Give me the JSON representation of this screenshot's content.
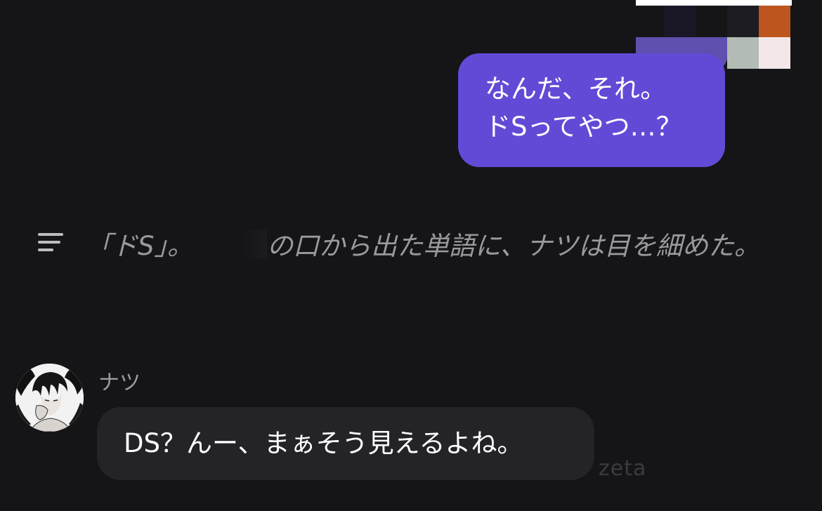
{
  "user_message": {
    "lines": [
      "なんだ、それ。",
      "ドSってやつ…？"
    ],
    "bubble_color": "#634ad6"
  },
  "narration": {
    "before_censor": "「ドS」。",
    "after_censor": "の口から出た単語に、ナツは目を細めた。",
    "icon": "menu-lines-icon"
  },
  "character": {
    "name": "ナツ",
    "avatar_icon": "manga-avatar-icon",
    "message": "DS？んー、まぁそう見えるよね。"
  },
  "watermark": "zeta",
  "colors": {
    "background": "#151518",
    "character_bubble": "#242428",
    "narration_text": "#9a9a9d"
  }
}
